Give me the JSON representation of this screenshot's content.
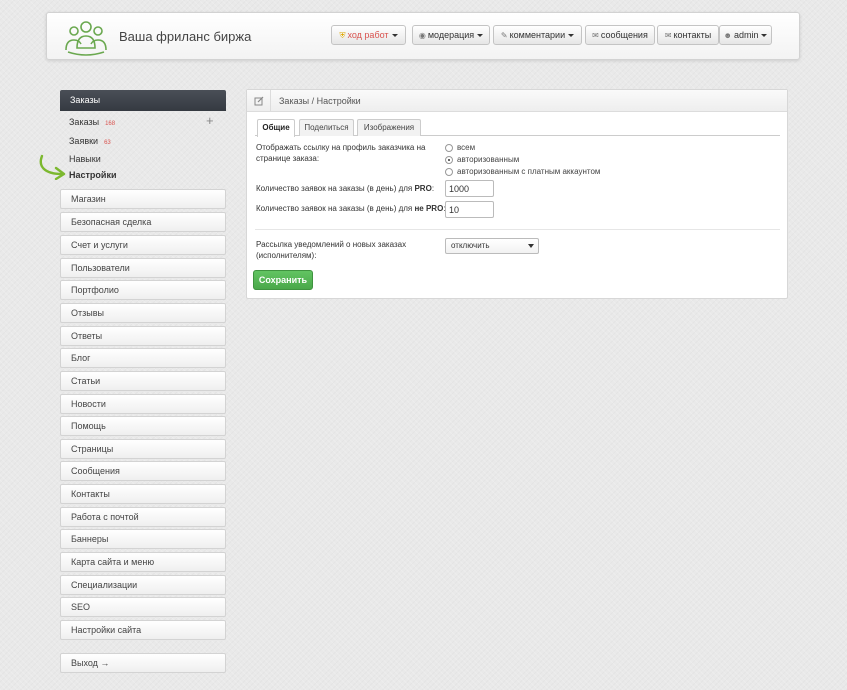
{
  "header": {
    "site_title": "Ваша фриланс биржа",
    "nav": [
      {
        "icon": "shield-icon",
        "label": "ход работ",
        "dropdown": true,
        "style": "warning"
      },
      {
        "icon": "eye-icon",
        "label": "модерация",
        "dropdown": true
      },
      {
        "icon": "pencil-icon",
        "label": "комментарии",
        "dropdown": true
      },
      {
        "icon": "envelope-icon",
        "label": "сообщения",
        "dropdown": false
      },
      {
        "icon": "envelope-icon",
        "label": "контакты",
        "dropdown": false
      },
      {
        "icon": "user-icon",
        "label": "admin",
        "dropdown": true
      }
    ]
  },
  "sidebar": {
    "section_title": "Заказы",
    "subitems": [
      {
        "label": "Заказы",
        "count": "168"
      },
      {
        "label": "Заявки",
        "count": "63"
      },
      {
        "label": "Навыки",
        "count": ""
      },
      {
        "label": "Настройки",
        "count": "",
        "active": true
      }
    ],
    "menu": [
      "Магазин",
      "Безопасная сделка",
      "Счет и услуги",
      "Пользователи",
      "Портфолио",
      "Отзывы",
      "Ответы",
      "Блог",
      "Статьи",
      "Новости",
      "Помощь",
      "Страницы",
      "Сообщения",
      "Контакты",
      "Работа с почтой",
      "Баннеры",
      "Карта сайта и меню",
      "Специализации",
      "SEO",
      "Настройки сайта"
    ],
    "logout_label": "Выход →"
  },
  "panel": {
    "breadcrumb": "Заказы / Настройки",
    "tabs": [
      {
        "label": "Общие",
        "active": true
      },
      {
        "label": "Поделиться",
        "active": false
      },
      {
        "label": "Изображения",
        "active": false
      }
    ],
    "profile_link_label_1": "Отображать ссылку на профиль заказчика на",
    "profile_link_label_2": "странице заказа:",
    "profile_link_options": [
      {
        "label": "всем",
        "checked": false
      },
      {
        "label": "авторизованным",
        "checked": true
      },
      {
        "label": "авторизованным с платным аккаунтом",
        "checked": false
      }
    ],
    "pro_limit_label_prefix": "Количество заявок на заказы (в день) для ",
    "pro_limit_label_bold": "PRO",
    "pro_limit_value": "1000",
    "nonpro_limit_label_prefix": "Количество заявок на заказы (в день) для ",
    "nonpro_limit_label_bold": "не PRO",
    "nonpro_limit_value": "10",
    "notify_label_1": "Рассылка уведомлений о новых заказах",
    "notify_label_2": "(исполнителям):",
    "notify_selected": "отключить",
    "save_label": "Сохранить"
  },
  "colors": {
    "accent_green": "#5cb85c",
    "sidebar_header": "#3d4249",
    "warning_red": "#d9534f",
    "arrow_green": "#7cb82f"
  }
}
